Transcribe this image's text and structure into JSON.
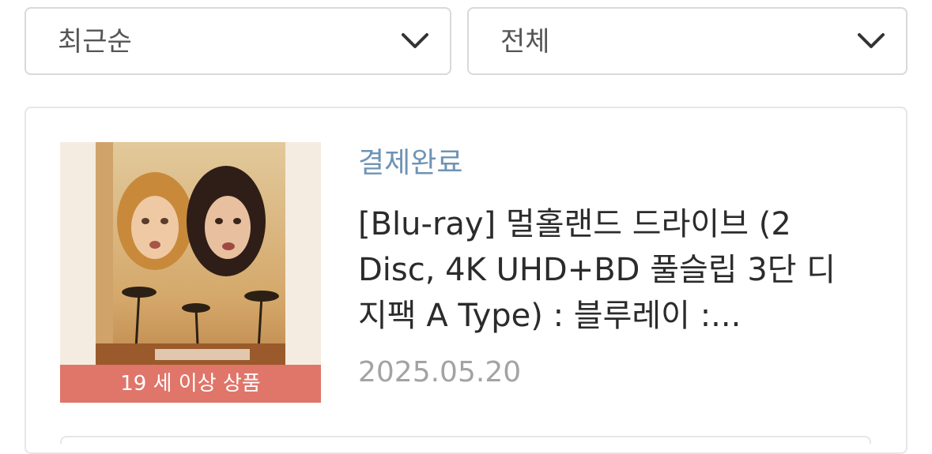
{
  "filters": {
    "sort": {
      "selected": "최근순",
      "icon": "chevron-down-icon"
    },
    "category": {
      "selected": "전체",
      "icon": "chevron-down-icon"
    }
  },
  "order": {
    "status": "결제완료",
    "status_color": "#6f93b4",
    "product_title": "[Blu-ray] 멀홀랜드 드라이브 (2 Disc, 4K UHD+BD 풀슬립 3단 디지팩 A Type) : 블루레이 :...",
    "date": "2025.05.20",
    "age_badge": "19 세 이상 상품",
    "age_badge_color": "#e0756a"
  }
}
